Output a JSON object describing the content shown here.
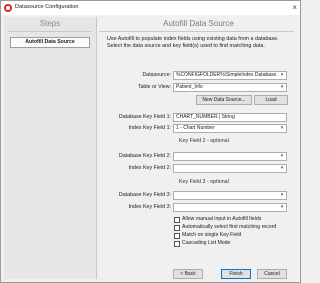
{
  "window": {
    "title": "Datasource Configuration",
    "close_glyph": "×"
  },
  "steps": {
    "header": "Steps",
    "items": [
      {
        "label": "Autofill Data Source",
        "active": true
      }
    ]
  },
  "main": {
    "header": "Autofill Data Source",
    "intro": "Use Autofill to populate index fields using existing data from a database. Select the data source and key field(s) used to find matching data.",
    "datasource": {
      "label": "Datasource:",
      "value": "%CONFIGFOLDER%\\SimpleIndex Database."
    },
    "table": {
      "label": "Table or View:",
      "value": "Patient_Info"
    },
    "new_data_source_button": "New Data Source...",
    "load_button": "Load",
    "key1": {
      "db_label": "Database Key Field 1:",
      "db_value": "CHART_NUMBER | String",
      "index_label": "Index Key Field 1:",
      "index_value": "1 - Chart Number"
    },
    "key2": {
      "section_title": "Key Field 2 - optional",
      "db_label": "Database Key Field 2:",
      "db_value": "",
      "index_label": "Index Key Field 2:",
      "index_value": ""
    },
    "key3": {
      "section_title": "Key Field 3 - optional",
      "db_label": "Database Key Field 3:",
      "db_value": "",
      "index_label": "Index Key Field 3:",
      "index_value": ""
    },
    "options": [
      {
        "label": "Allow manual input in Autofill fields",
        "checked": false
      },
      {
        "label": "Automatically select first matching record",
        "checked": false
      },
      {
        "label": "Match on single Key Field",
        "checked": false
      },
      {
        "label": "Cascading List Mode",
        "checked": false
      }
    ]
  },
  "footer": {
    "back": "< Back",
    "finish": "Finish",
    "cancel": "Cancel"
  },
  "icons": {
    "app": "app-logo-icon",
    "dropdown": "chevron-down-icon"
  },
  "colors": {
    "accent": "#0078d7",
    "app_red": "#d22a2a"
  }
}
